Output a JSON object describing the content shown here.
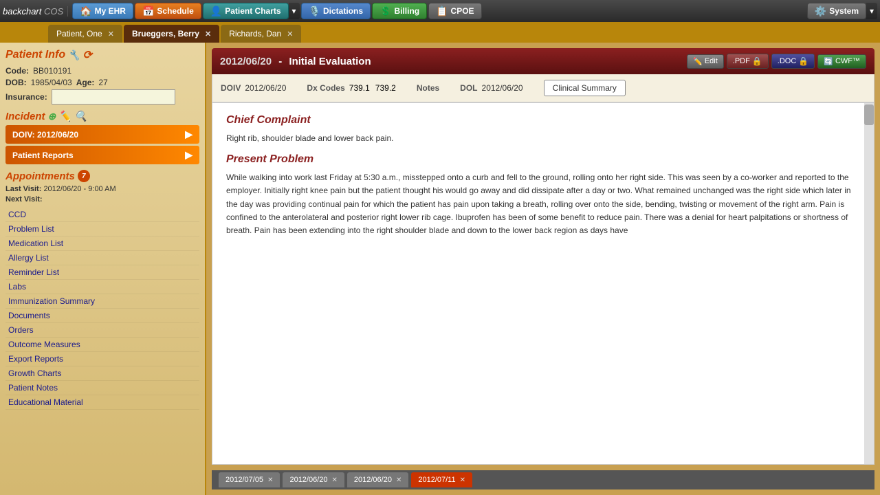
{
  "brand": {
    "name": "backchart",
    "suffix": "COS"
  },
  "nav": {
    "my_ehr": "My EHR",
    "schedule": "Schedule",
    "patient_charts": "Patient Charts",
    "dictations": "Dictations",
    "billing": "Billing",
    "cpoe": "CPOE",
    "system": "System"
  },
  "patient_tabs": [
    {
      "name": "Patient, One",
      "active": false
    },
    {
      "name": "Brueggers, Berry",
      "active": true
    },
    {
      "name": "Richards, Dan",
      "active": false
    }
  ],
  "sidebar": {
    "patient_info_label": "Patient Info",
    "code_label": "Code:",
    "code_value": "BB010191",
    "dob_label": "DOB:",
    "dob_value": "1985/04/03",
    "age_label": "Age:",
    "age_value": "27",
    "insurance_label": "Insurance:",
    "insurance_value": "",
    "incident_label": "Incident",
    "doiv_btn": "DOIV: 2012/06/20",
    "patient_reports_btn": "Patient Reports",
    "appointments_label": "Appointments",
    "appointments_badge": "7",
    "last_visit_label": "Last Visit:",
    "last_visit_value": "2012/06/20 - 9:00 AM",
    "next_visit_label": "Next Visit:",
    "next_visit_value": "",
    "menu_items": [
      "CCD",
      "Problem List",
      "Medication List",
      "Allergy List",
      "Reminder List",
      "Labs",
      "Immunization Summary",
      "Documents",
      "Orders",
      "Outcome Measures",
      "Export Reports",
      "Growth Charts",
      "Patient Notes",
      "Educational Material"
    ]
  },
  "document": {
    "date": "2012/06/20",
    "separator": "-",
    "title": "Initial Evaluation",
    "edit_label": "Edit",
    "pdf_label": ".PDF",
    "doc_label": ".DOC",
    "cwf_label": "CWF™",
    "doiv_label": "DOIV",
    "doiv_value": "2012/06/20",
    "dx_codes_label": "Dx Codes",
    "dx_code1": "739.1",
    "dx_code2": "739.2",
    "notes_label": "Notes",
    "dol_label": "DOL",
    "dol_value": "2012/06/20",
    "clinical_summary_btn": "Clinical Summary",
    "chief_complaint_heading": "Chief Complaint",
    "chief_complaint_text": "Right rib, shoulder blade and lower back pain.",
    "present_problem_heading": "Present Problem",
    "present_problem_text": "While walking into work last Friday at 5:30 a.m., misstepped onto a curb and fell to the ground, rolling onto her right side. This was seen by a co-worker and reported to the employer. Initially right knee pain but the patient thought his would go away and did dissipate after a day or two. What remained unchanged was the right side which later in the day was providing continual pain for which the patient has pain upon taking a breath, rolling over onto the side, bending, twisting or movement of the right arm. Pain is confined to the anterolateral and posterior right lower rib cage. Ibuprofen has been of some benefit to reduce pain. There was a denial for heart palpitations or shortness of breath. Pain has been extending into the right shoulder blade and down to the lower back region as days have"
  },
  "bottom_tabs": [
    {
      "date": "2012/07/05",
      "active": false
    },
    {
      "date": "2012/06/20",
      "active": false
    },
    {
      "date": "2012/06/20",
      "active": false
    },
    {
      "date": "2012/07/11",
      "active": true
    }
  ]
}
